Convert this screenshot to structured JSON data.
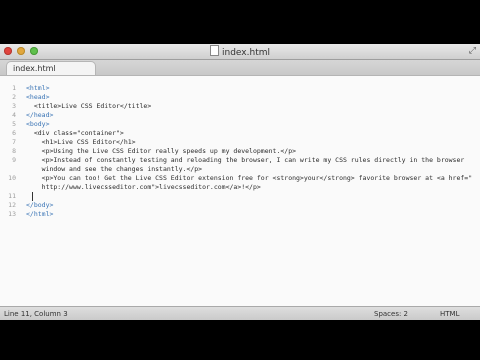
{
  "window": {
    "title": "index.html",
    "fullscreen_icon": "fullscreen-arrows-icon"
  },
  "tabs": [
    {
      "label": "index.html"
    }
  ],
  "editor": {
    "line_numbers": [
      "1",
      "2",
      "3",
      "4",
      "5",
      "6",
      "7",
      "8",
      "9",
      "",
      "10",
      "",
      "11",
      "12",
      "13"
    ],
    "lines": [
      "<html>",
      "<head>",
      "  <title>Live CSS Editor</title>",
      "</head>",
      "<body>",
      "  <div class=\"container\">",
      "    <h1>Live CSS Editor</h1>",
      "    <p>Using the Live CSS Editor really speeds up my development.</p>",
      "    <p>Instead of constantly testing and reloading the browser, I can write my CSS rules directly in the browser",
      "    window and see the changes instantly.</p>",
      "    <p>You can too! Get the Live CSS Editor extension free for <strong>your</strong> favorite browser at <a href=\"",
      "    http://www.livecsseditor.com\">livecsseditor.com</a>!</p>",
      "",
      "</body>",
      "</html>"
    ]
  },
  "status": {
    "position": "Line 11, Column 3",
    "spaces": "Spaces: 2",
    "syntax": "HTML"
  }
}
